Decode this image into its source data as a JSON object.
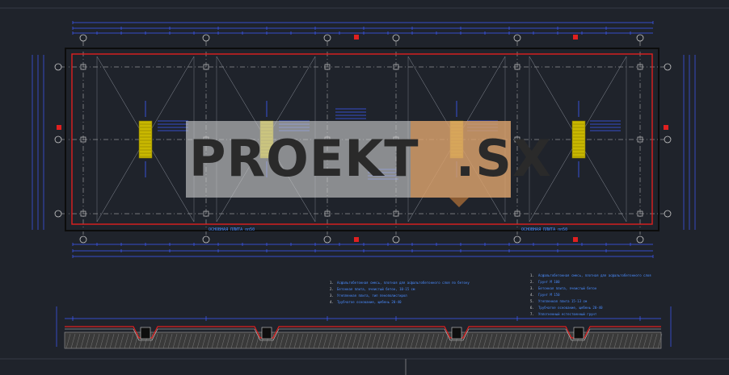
{
  "watermark": {
    "text": "PROEKT  .SX"
  },
  "plan": {
    "gutter_label_left": "ОСНОВНАЯ ПЛИТА пп50",
    "gutter_label_right": "ОСНОВНАЯ ПЛИТА пп50"
  },
  "section": {
    "notes_left": [
      {
        "num": "1.",
        "text": "Асфальтобетонная смесь, плотная для асфальтобетонного слоя по бетону"
      },
      {
        "num": "2.",
        "text": "Бетонная плита, ячеистый бетон, 10-15 см"
      },
      {
        "num": "3.",
        "text": "Утепленная плита, тип пенополистирол"
      },
      {
        "num": "4.",
        "text": "Трубчатое основание, щебень 20-40"
      }
    ],
    "notes_right": [
      {
        "num": "1.",
        "text": "Асфальтобетонная смесь, плотная для асфальтобетонного слоя"
      },
      {
        "num": "2.",
        "text": "Грунт М 100"
      },
      {
        "num": "3.",
        "text": "Бетонная плита, ячеистый бетон"
      },
      {
        "num": "4.",
        "text": "Грунт М 150"
      },
      {
        "num": "5.",
        "text": "Утепленная плита 15-13 см"
      },
      {
        "num": "6.",
        "text": "Трубчатое основание, щебень 20-40"
      },
      {
        "num": "7.",
        "text": "Уплотненный естественный грунт"
      }
    ]
  },
  "colors": {
    "background": "#1f232b",
    "dimension": "#3e5cff",
    "slab_outline": "#e02020",
    "grid": "#c8c8c8",
    "drain": "#c9b800"
  }
}
